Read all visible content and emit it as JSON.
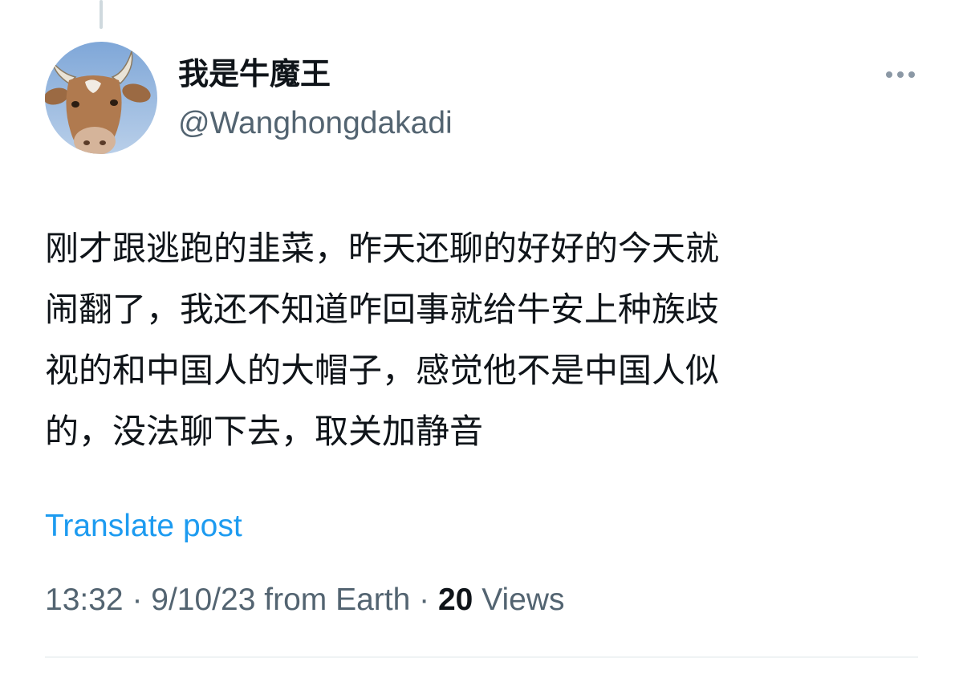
{
  "author": {
    "display_name": "我是牛魔王",
    "handle": "@Wanghongdakadi",
    "avatar_icon": "cow-avatar"
  },
  "more_icon": "more-horizontal-icon",
  "tweet": {
    "lines": [
      "刚才跟逃跑的韭菜，昨天还聊的好好的今天就",
      "闹翻了，我还不知道咋回事就给牛安上种族歧",
      "视的和中国人的大帽子，感觉他不是中国人似",
      "的，没法聊下去，取关加静音"
    ]
  },
  "translate_label": "Translate post",
  "meta": {
    "time": "13:32",
    "separator": " · ",
    "date": "9/10/23",
    "source": " from Earth",
    "views_count": "20",
    "views_label": " Views"
  },
  "colors": {
    "link": "#1d9bf0",
    "secondary_text": "#536471",
    "primary_text": "#0f1419"
  }
}
